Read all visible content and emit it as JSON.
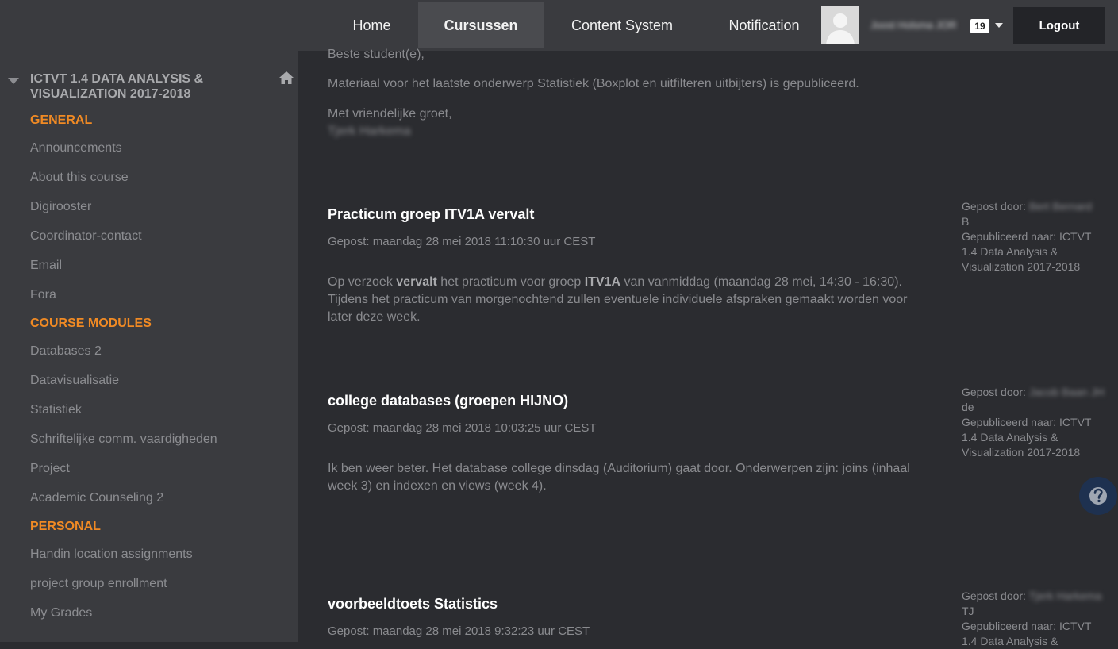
{
  "nav": {
    "home": "Home",
    "cursussen": "Cursussen",
    "content_system": "Content System",
    "notification": "Notification",
    "user_name": "Joost Holsma JOR",
    "badge_count": "19",
    "logout": "Logout"
  },
  "sidebar": {
    "course_title": "ICTVT 1.4 DATA ANALYSIS & VISUALIZATION 2017-2018",
    "sections": [
      {
        "label": "GENERAL",
        "items": [
          "Announcements",
          "About this course",
          "Digirooster",
          "Coordinator-contact",
          "Email",
          "Fora"
        ]
      },
      {
        "label": "COURSE MODULES",
        "items": [
          "Databases 2",
          "Datavisualisatie",
          "Statistiek",
          "Schriftelijke comm. vaardigheden",
          "Project",
          "Academic Counseling 2"
        ]
      },
      {
        "label": "PERSONAL",
        "items": [
          "Handin location assignments",
          "project group enrollment",
          "My Grades"
        ]
      }
    ]
  },
  "main": {
    "intro": {
      "greeting": "Beste student(e),",
      "body": "Materiaal voor het laatste onderwerp Statistiek (Boxplot en uitfilteren uitbijters) is gepubliceerd.",
      "closing": "Met vriendelijke groet,",
      "signature": "Tjerk Harkema"
    },
    "announcements": [
      {
        "title": "Practicum groep ITV1A vervalt",
        "date": "Gepost: maandag 28 mei 2018 11:10:30 uur CEST",
        "body_parts": [
          "Op verzoek ",
          "vervalt",
          " het practicum voor groep ",
          "ITV1A",
          " van vanmiddag (maandag 28 mei, 14:30 - 16:30). Tijdens het practicum van morgenochtend zullen eventuele individuele afspraken gemaakt worden voor later deze week."
        ],
        "posted_by_label": "Gepost door:",
        "posted_by": "Bert Bernard",
        "posted_by_suffix": "B",
        "published_to": "Gepubliceerd naar: ICTVT 1.4 Data Analysis & Visualization 2017-2018"
      },
      {
        "title": "college databases (groepen HIJNO)",
        "date": "Gepost: maandag 28 mei 2018 10:03:25 uur CEST",
        "body_parts": [
          "Ik ben weer beter. Het database college dinsdag (Auditorium) gaat door. Onderwerpen zijn: joins (inhaal week 3) en indexen en views (week 4)."
        ],
        "posted_by_label": "Gepost door:",
        "posted_by": "Jacob Baan JH",
        "posted_by_suffix": "de",
        "published_to": "Gepubliceerd naar: ICTVT 1.4 Data Analysis & Visualization 2017-2018"
      },
      {
        "title": "voorbeeldtoets Statistics",
        "date": "Gepost: maandag 28 mei 2018 9:32:23 uur CEST",
        "posted_by_label": "Gepost door:",
        "posted_by": "Tjerk Harkema",
        "posted_by_suffix": "TJ",
        "published_to": "Gepubliceerd naar: ICTVT 1.4 Data Analysis &"
      }
    ]
  },
  "colors": {
    "topbar": "#3a3b3f",
    "sidebar": "#3a3b3f",
    "content": "#2b2c30",
    "section_accent": "#f08a24",
    "help_button": "#1e3150"
  },
  "icons": [
    "user-avatar-icon",
    "caret-down-icon",
    "collapse-triangle-icon",
    "home-icon",
    "question-mark-icon"
  ]
}
